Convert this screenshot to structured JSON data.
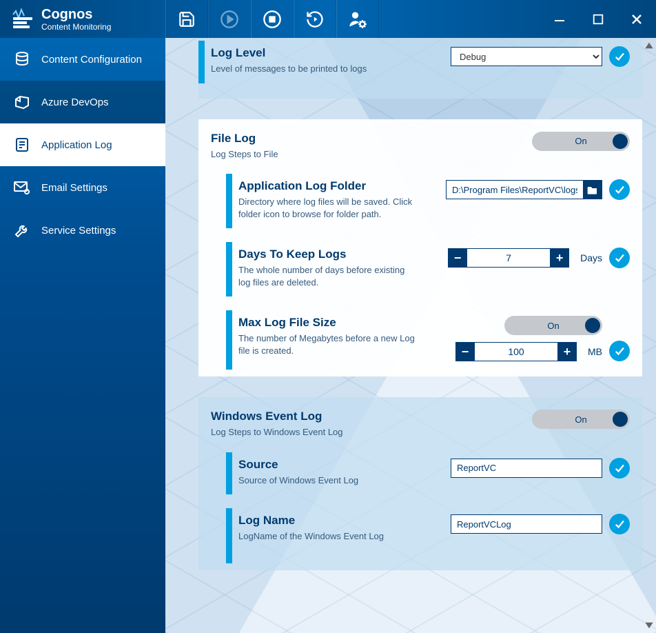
{
  "app": {
    "title": "Cognos",
    "subtitle": "Content Monitoring"
  },
  "sidebar": {
    "items": [
      {
        "label": "Content Configuration"
      },
      {
        "label": "Azure DevOps"
      },
      {
        "label": "Application Log"
      },
      {
        "label": "Email Settings"
      },
      {
        "label": "Service Settings"
      }
    ]
  },
  "logLevel": {
    "title": "Log Level",
    "desc": "Level of messages to be printed to logs",
    "value": "Debug"
  },
  "fileLog": {
    "title": "File Log",
    "desc": "Log Steps to File",
    "toggle": "On",
    "folder": {
      "title": "Application Log Folder",
      "desc": "Directory where log files will be saved. Click folder icon to browse for folder path.",
      "value": "D:\\Program Files\\ReportVC\\logs"
    },
    "days": {
      "title": "Days To Keep Logs",
      "desc": "The whole number of days before existing log files are deleted.",
      "value": "7",
      "unit": "Days"
    },
    "maxSize": {
      "title": "Max Log File Size",
      "desc": "The number of Megabytes before a new Log file is created.",
      "toggle": "On",
      "value": "100",
      "unit": "MB"
    }
  },
  "winLog": {
    "title": "Windows Event Log",
    "desc": "Log Steps to Windows Event Log",
    "toggle": "On",
    "source": {
      "title": "Source",
      "desc": "Source of Windows Event Log",
      "value": "ReportVC"
    },
    "logName": {
      "title": "Log Name",
      "desc": "LogName of the Windows Event Log",
      "value": "ReportVCLog"
    }
  }
}
